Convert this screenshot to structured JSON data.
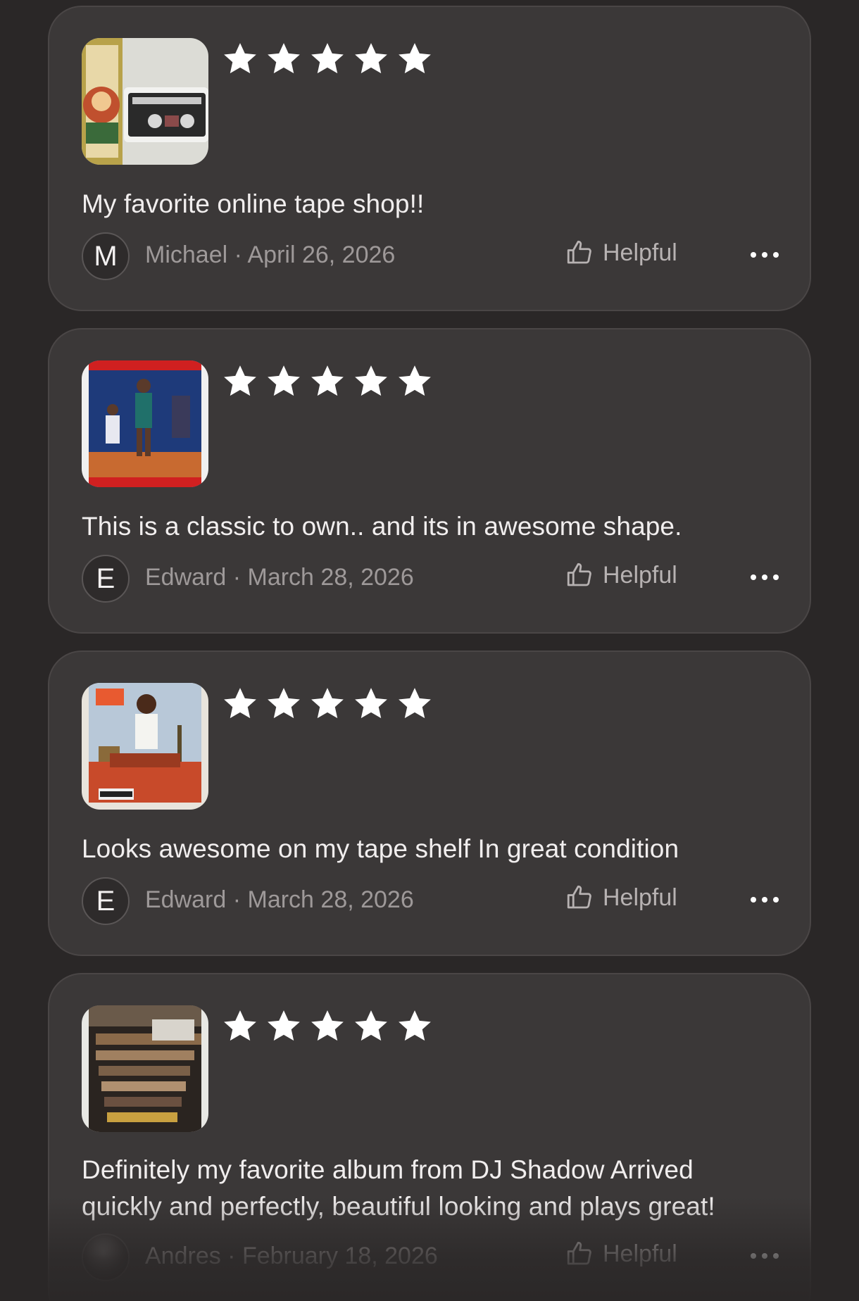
{
  "reviews": [
    {
      "rating": 5,
      "thumbnail_icon": "cassette-photo-icon",
      "text": "My favorite online tape shop!!",
      "avatar_initial": "M",
      "author": "Michael",
      "separator": "·",
      "date": "April 26, 2026",
      "author_line": "Michael · April 26, 2026",
      "helpful_label": "Helpful"
    },
    {
      "rating": 5,
      "thumbnail_icon": "basketball-cassette-cover-icon",
      "text": "This is a classic to own.. and its in awesome shape.",
      "avatar_initial": "E",
      "author": "Edward",
      "separator": "·",
      "date": "March 28, 2026",
      "author_line": "Edward · March 28, 2026",
      "helpful_label": "Helpful"
    },
    {
      "rating": 5,
      "thumbnail_icon": "car-album-cover-icon",
      "text": "Looks awesome on my tape shelf In great condition",
      "avatar_initial": "E",
      "author": "Edward",
      "separator": "·",
      "date": "March 28, 2026",
      "author_line": "Edward · March 28, 2026",
      "helpful_label": "Helpful"
    },
    {
      "rating": 5,
      "thumbnail_icon": "record-store-cover-icon",
      "text_line1": "Definitely my favorite album from DJ Shadow Arrived",
      "text_line2": "quickly and perfectly, beautiful looking and plays great!",
      "avatar_initial": "",
      "author": "Andres",
      "separator": "·",
      "date": "February 18, 2026",
      "author_line": "Andres · February 18, 2026",
      "helpful_label": "Helpful"
    }
  ],
  "colors": {
    "background": "#2a2727",
    "card": "#3b3838",
    "star": "#ffffff",
    "text": "#f1eeee",
    "muted": "#9e9999"
  }
}
